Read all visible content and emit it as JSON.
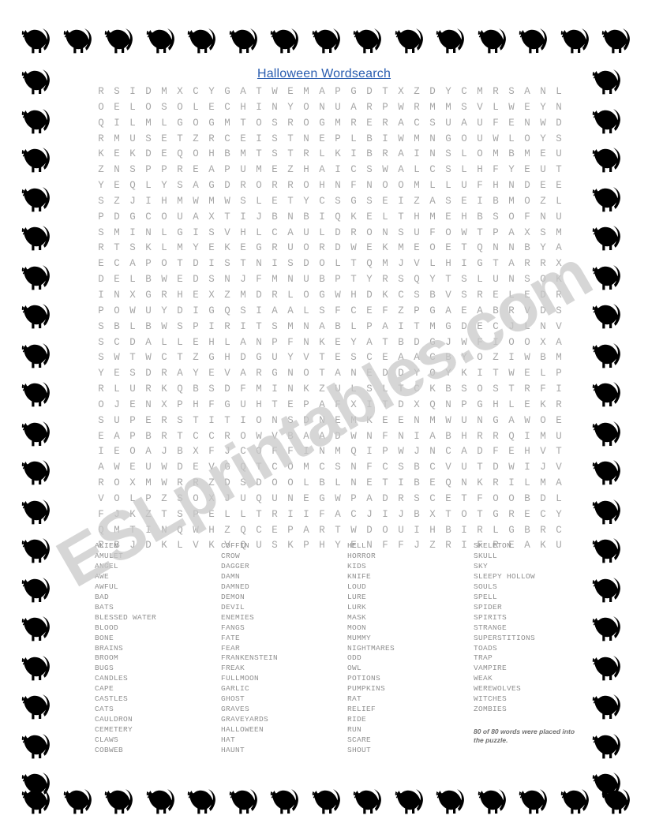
{
  "header": {
    "title": "Halloween Wordsearch",
    "title_color": "#2a5db0"
  },
  "watermark": {
    "text": "ESLprintables.com",
    "color": "#c9c9c9"
  },
  "border": {
    "icon": "black-cat-silhouette",
    "color": "#000000",
    "count_top": 15,
    "count_bottom": 15,
    "count_left": 20,
    "count_right": 20
  },
  "puzzle": {
    "rows": 28,
    "cols": 30,
    "letter_color": "#a6a6a6",
    "grid": [
      "RSIDMXCYGATWEMAPGDTXZDYCMRSANL",
      "OELOSOLECHINYONUARPWRMMSVLWEYN",
      "QILMLGOGMTOSROGMRERACSUAUFENWD",
      "RMUSETZRCEISTNEPLBIWMNGOUWLOYS",
      "KEKDEQOHBMTSTRLKIBRAINSLOMBMEU",
      "ZNSPPREAPUMEZHAICSWALCSLHFYEUT",
      "YEQLYSAGDRORROHNFNOOMLLUFHNDEE",
      "SZJIHMWMWSLETYCSGSEIZASEIBMOZL",
      "PDGCOUAXTIJBNBIQKELTHMEHBSOFNU",
      "SMINLGISVHLCAULDRONSUFOWTPAXSM",
      "RTSKLMYEKEGRUORDWEKMEOETQNNBYA",
      "ECAPOTDISTNISDOLTQMJVLHIGTARRX",
      "DELBWEDSNJFMNUBPTYRSQYTSLUNSOK",
      "INXGRHEXZMDRLOGWHDKCSBVSRELEDR",
      "POWUYDIGQSIAALSFCEFZPGAEABRVDS",
      "SBLBWSPIRITSMNABLPAITMGDECJLNV",
      "SCDALLEHLANPFNKEYATBDGJWFIOOXA",
      "SWTWCTZGHDGUYVTESCEAACBYOZIWBM",
      "YESDRAYEVARGNOTANEDDYOYKITWELP",
      "RLURKQBSDFMINKZULSLTCKBSOSTRFI",
      "OJENXPHFGUHTEPAFXITDXQNPGHLEKR",
      "SUPERSTITIONSDNEMKEENMWUNGAWOE",
      "EAPBRTCCROWVBAADWNFNIABHRRQIMU",
      "IEOAJBXFJCOFFINMQIPWJNCADFEHVT",
      "AWEUWDEVGQTCOMCSNFCSBCVUTDWIJV",
      "ROXMWRRZDSDOOLBLNETIBEQNKRILMA",
      "VOLPZSOXJUQUNEGWPADRSCETFOOBDL",
      "FJKZTSPELLTRIIFACJIJBXTOTGRECY",
      "QMTINQWHZQCEPARTWDOUIHBIRLGBRC",
      "RBJDKLVKVQUSKPHYENFFJZRIFREAKU"
    ]
  },
  "wordlist": {
    "columns": [
      {
        "words": [
          "ALIEN",
          "AMULET",
          "ANGEL",
          "AWE",
          "AWFUL",
          "BAD",
          "BATS",
          "BLESSED WATER",
          "BLOOD",
          "BONE",
          "BRAINS",
          "BROOM",
          "BUGS",
          "CANDLES",
          "CAPE",
          "CASTLES",
          "CATS",
          "CAULDRON",
          "CEMETERY",
          "CLAWS",
          "COBWEB"
        ]
      },
      {
        "words": [
          "COFFIN",
          "CROW",
          "DAGGER",
          "DAMN",
          "DAMNED",
          "DEMON",
          "DEVIL",
          "ENEMIES",
          "FANGS",
          "FATE",
          "FEAR",
          "FRANKENSTEIN",
          "FREAK",
          "FULLMOON",
          "GARLIC",
          "GHOST",
          "GRAVES",
          "GRAVEYARDS",
          "HALLOWEEN",
          "HAT",
          "HAUNT"
        ]
      },
      {
        "words": [
          "HELL",
          "HORROR",
          "KIDS",
          "KNIFE",
          "LOUD",
          "LURE",
          "LURK",
          "MASK",
          "MOON",
          "MUMMY",
          "NIGHTMARES",
          "ODD",
          "OWL",
          "POTIONS",
          "PUMPKINS",
          "RAT",
          "RELIEF",
          "RIDE",
          "RUN",
          "SCARE",
          "SHOUT"
        ]
      },
      {
        "words": [
          "SKELETON",
          "SKULL",
          "SKY",
          "SLEEPY HOLLOW",
          "SOULS",
          "SPELL",
          "SPIDER",
          "SPIRITS",
          "STRANGE",
          "SUPERSTITIONS",
          "TOADS",
          "TRAP",
          "VAMPIRE",
          "WEAK",
          "WEREWOLVES",
          "WITCHES",
          "ZOMBIES"
        ]
      }
    ],
    "total_words": 80,
    "footnote": "80 of 80 words were placed into the puzzle."
  }
}
